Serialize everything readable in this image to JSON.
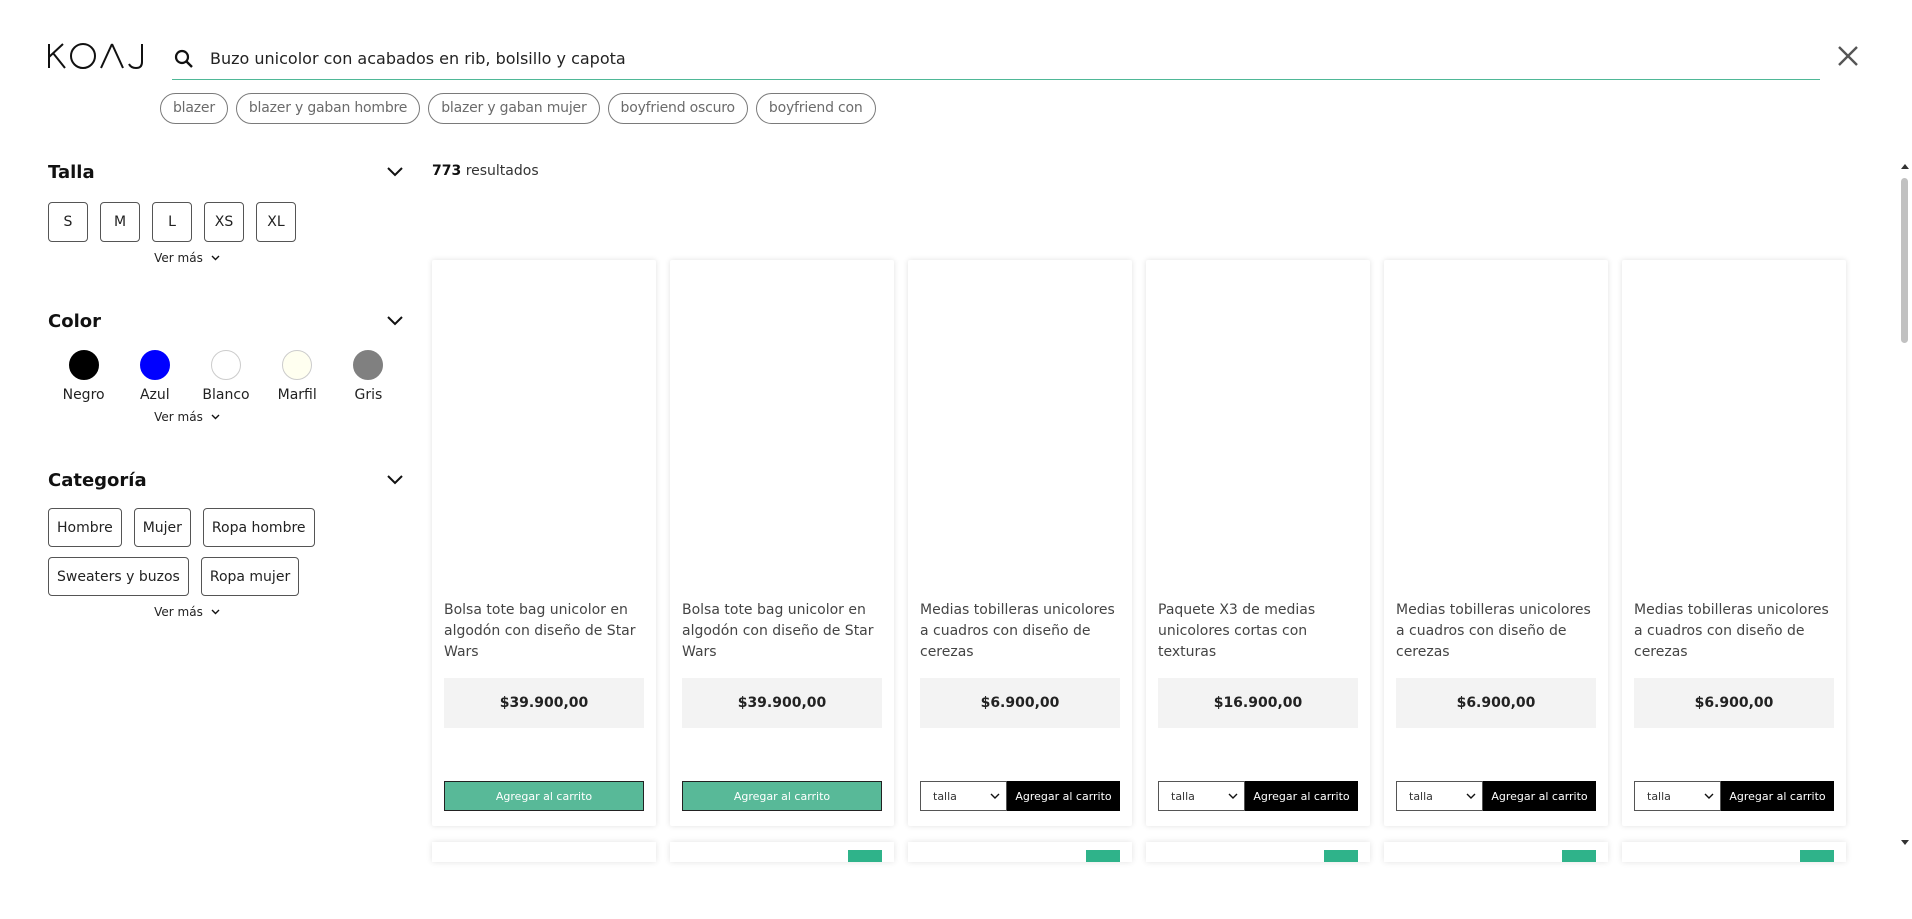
{
  "brand": {
    "logo_text": "KOAJ"
  },
  "search": {
    "value": "Buzo unicolor con acabados en rib, bolsillo y capota",
    "accent_color": "#4fb897"
  },
  "suggestions": [
    "blazer",
    "blazer y gaban hombre",
    "blazer y gaban mujer",
    "boyfriend oscuro",
    "boyfriend con"
  ],
  "filters": {
    "talla": {
      "title": "Talla",
      "options": [
        "S",
        "M",
        "L",
        "XS",
        "XL"
      ],
      "more": "Ver más"
    },
    "color": {
      "title": "Color",
      "options": [
        {
          "label": "Negro",
          "hex": "#000000"
        },
        {
          "label": "Azul",
          "hex": "#0000ff"
        },
        {
          "label": "Blanco",
          "hex": "#ffffff"
        },
        {
          "label": "Marfil",
          "hex": "#fffff0"
        },
        {
          "label": "Gris",
          "hex": "#808080"
        }
      ],
      "more": "Ver más"
    },
    "categoria": {
      "title": "Categoría",
      "options": [
        "Hombre",
        "Mujer",
        "Ropa hombre",
        "Sweaters y buzos",
        "Ropa mujer"
      ],
      "more": "Ver más"
    }
  },
  "results": {
    "count": "773",
    "label": "resultados"
  },
  "products": [
    {
      "title": "Bolsa tote bag unicolor en algodón con diseño de Star Wars",
      "price": "$39.900,00",
      "button": "Agregar al carrito",
      "style": "green"
    },
    {
      "title": "Bolsa tote bag unicolor en algodón con diseño de Star Wars",
      "price": "$39.900,00",
      "button": "Agregar al carrito",
      "style": "green"
    },
    {
      "title": "Medias tobilleras unicolores a cuadros con diseño de cerezas",
      "price": "$6.900,00",
      "button": "Agregar al carrito",
      "style": "black",
      "size_placeholder": "talla"
    },
    {
      "title": "Paquete X3 de medias unicolores cortas con texturas",
      "price": "$16.900,00",
      "button": "Agregar al carrito",
      "style": "black",
      "size_placeholder": "talla"
    },
    {
      "title": "Medias tobilleras unicolores a cuadros con diseño de cerezas",
      "price": "$6.900,00",
      "button": "Agregar al carrito",
      "style": "black",
      "size_placeholder": "talla"
    },
    {
      "title": "Medias tobilleras unicolores a cuadros con diseño de cerezas",
      "price": "$6.900,00",
      "button": "Agregar al carrito",
      "style": "black",
      "size_placeholder": "talla"
    }
  ],
  "colors": {
    "accent_green": "#58b998",
    "badge_green": "#2fb38a"
  }
}
